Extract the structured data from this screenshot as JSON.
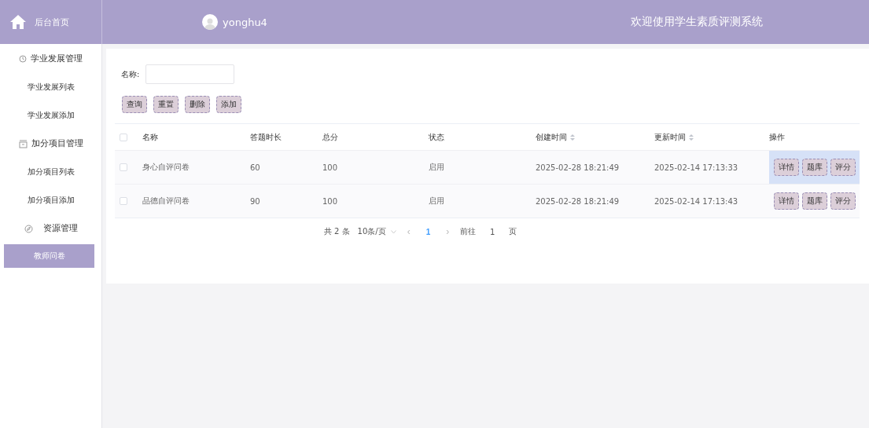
{
  "header": {
    "home_label": "后台首页",
    "username": "yonghu4",
    "title": "欢迎使用学生素质评测系统"
  },
  "sidebar": {
    "items": [
      {
        "kind": "group",
        "label": "学业发展管理",
        "selected": false
      },
      {
        "kind": "item",
        "label": "学业发展列表",
        "selected": false
      },
      {
        "kind": "item",
        "label": "学业发展添加",
        "selected": false
      },
      {
        "kind": "group",
        "label": "加分项目管理",
        "selected": false
      },
      {
        "kind": "item",
        "label": "加分项目列表",
        "selected": false
      },
      {
        "kind": "item",
        "label": "加分项目添加",
        "selected": false
      },
      {
        "kind": "group",
        "label": "资源管理",
        "selected": false
      },
      {
        "kind": "item",
        "label": "教师问卷",
        "selected": true
      }
    ]
  },
  "search": {
    "label": "名称:"
  },
  "buttons": [
    "查询",
    "重置",
    "删除",
    "添加"
  ],
  "table": {
    "select_all_checked": false,
    "columns": [
      {
        "label": "名称",
        "kind": "plain"
      },
      {
        "label": "答题时长",
        "kind": "plain"
      },
      {
        "label": "总分",
        "kind": "plain"
      },
      {
        "label": "状态",
        "kind": "plain"
      },
      {
        "label": "创建时间",
        "kind": "sortable"
      },
      {
        "label": "更新时间",
        "kind": "sortable"
      },
      {
        "label": "操作",
        "kind": "plain"
      }
    ],
    "rows": [
      {
        "checked": false,
        "highlighted": true,
        "cells": [
          "身心自评问卷",
          "60",
          "100",
          "启用",
          "2025-02-28 18:21:49",
          "2025-02-14 17:13:33"
        ],
        "actions": [
          "详情",
          "题库",
          "评分"
        ]
      },
      {
        "checked": false,
        "highlighted": false,
        "cells": [
          "品德自评问卷",
          "90",
          "100",
          "启用",
          "2025-02-28 18:21:49",
          "2025-02-14 17:13:43"
        ],
        "actions": [
          "详情",
          "题库",
          "评分"
        ]
      }
    ]
  },
  "pagination": {
    "total": "共 2 条",
    "page_size": "10条/页",
    "prev": "‹",
    "pages": [
      {
        "label": "1",
        "selected": true
      }
    ],
    "next": "›",
    "goto_label": "前往",
    "goto_value": "1",
    "goto_suffix": "页"
  }
}
